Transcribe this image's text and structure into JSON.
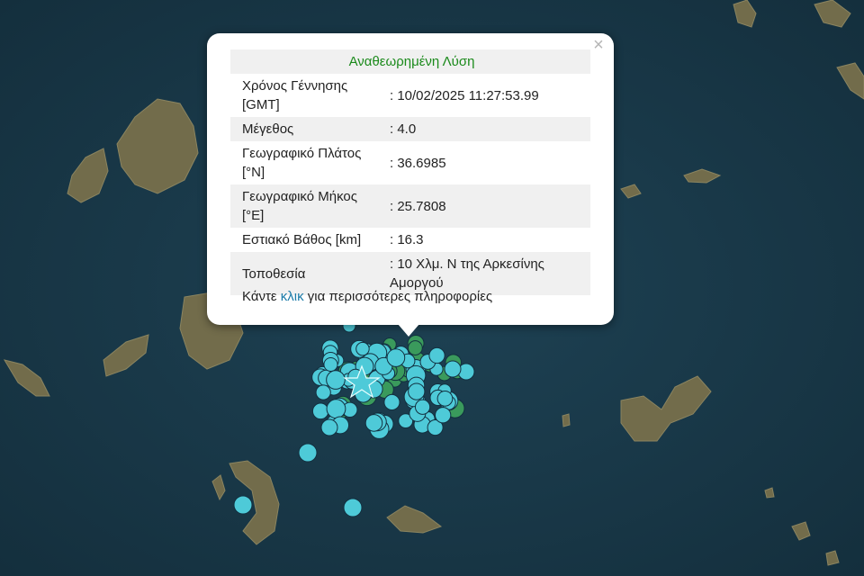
{
  "popup": {
    "title": "Αναθεωρημένη Λύση",
    "close_symbol": "×",
    "rows": [
      {
        "label": "Χρόνος Γέννησης [GMT]",
        "value": ": 10/02/2025 11:27:53.99"
      },
      {
        "label": "Μέγεθος",
        "value": ": 4.0"
      },
      {
        "label": "Γεωγραφικό Πλάτος [°N]",
        "value": ": 36.6985"
      },
      {
        "label": "Γεωγραφικό Μήκος [°E]",
        "value": ": 25.7808"
      },
      {
        "label": "Εστιακό Βάθος [km]",
        "value": ": 16.3"
      },
      {
        "label": "Τοποθεσία",
        "value": ": 10 Χλμ. Ν της Αρκεσίνης Αμοργού"
      }
    ],
    "footer": {
      "prefix": "Κάντε ",
      "link": "κλικ",
      "suffix": " για περισσότερες πληροφορίες"
    }
  },
  "map": {
    "sea_color": "#1a3a4a",
    "land_color": "#6f6a48",
    "marker_colors": {
      "cyan": "#4ecad8",
      "green": "#3a9a5c",
      "outline": "#123040"
    },
    "icons": {
      "epicenter": "star-icon",
      "close": "close-icon"
    }
  }
}
